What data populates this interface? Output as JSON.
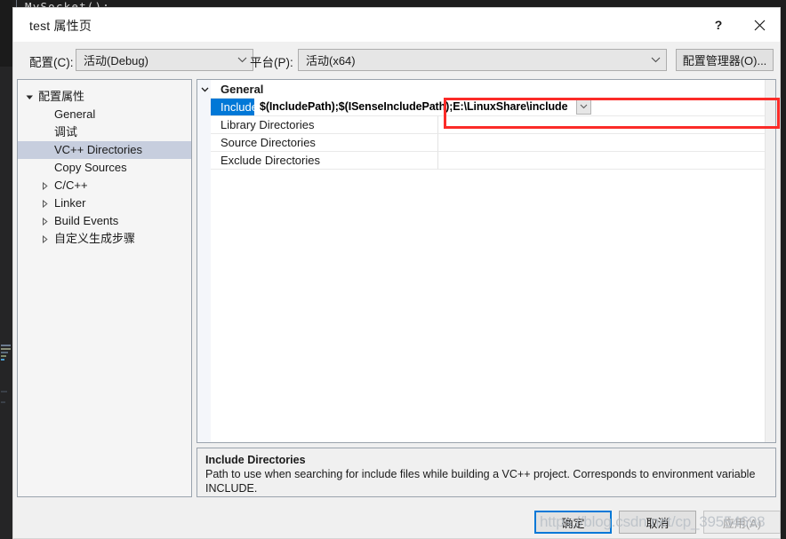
{
  "background": {
    "code_line": "MySocket();"
  },
  "dialog": {
    "title": "test 属性页",
    "help_label": "?",
    "close_label": "✕",
    "config": {
      "label": "配置(C):",
      "value": "活动(Debug)"
    },
    "platform": {
      "label": "平台(P):",
      "value": "活动(x64)"
    },
    "config_manager_label": "配置管理器(O)...",
    "tree": [
      {
        "label": "配置属性",
        "level": 0,
        "expander": "expanded",
        "selected": false
      },
      {
        "label": "General",
        "level": 1,
        "expander": "none",
        "selected": false
      },
      {
        "label": "调试",
        "level": 1,
        "expander": "none",
        "selected": false
      },
      {
        "label": "VC++ Directories",
        "level": 1,
        "expander": "none",
        "selected": true
      },
      {
        "label": "Copy Sources",
        "level": 1,
        "expander": "none",
        "selected": false
      },
      {
        "label": "C/C++",
        "level": 1,
        "expander": "collapsed",
        "selected": false
      },
      {
        "label": "Linker",
        "level": 1,
        "expander": "collapsed",
        "selected": false
      },
      {
        "label": "Build Events",
        "level": 1,
        "expander": "collapsed",
        "selected": false
      },
      {
        "label": "自定义生成步骤",
        "level": 1,
        "expander": "collapsed",
        "selected": false
      }
    ],
    "grid": {
      "group_header": "General",
      "rows": [
        {
          "name": "Include Directories",
          "value": "$(IncludePath);$(ISenseIncludePath);E:\\LinuxShare\\include",
          "selected": true,
          "editing": true
        },
        {
          "name": "Library Directories",
          "value": "",
          "selected": false,
          "editing": false
        },
        {
          "name": "Source Directories",
          "value": "",
          "selected": false,
          "editing": false
        },
        {
          "name": "Exclude Directories",
          "value": "",
          "selected": false,
          "editing": false
        }
      ]
    },
    "description": {
      "title": "Include Directories",
      "body": "Path to use when searching for include files while building a VC++ project.  Corresponds to environment variable INCLUDE."
    },
    "footer": {
      "ok": "确定",
      "cancel": "取消",
      "apply": "应用(A)"
    }
  },
  "watermark": "https://blog.csdn.net/cp_39554698",
  "colors": {
    "accent": "#0078d7",
    "selection_tree": "#c7cede",
    "highlight_box": "#fb2b28",
    "dialog_bg": "#f0f0f0"
  }
}
